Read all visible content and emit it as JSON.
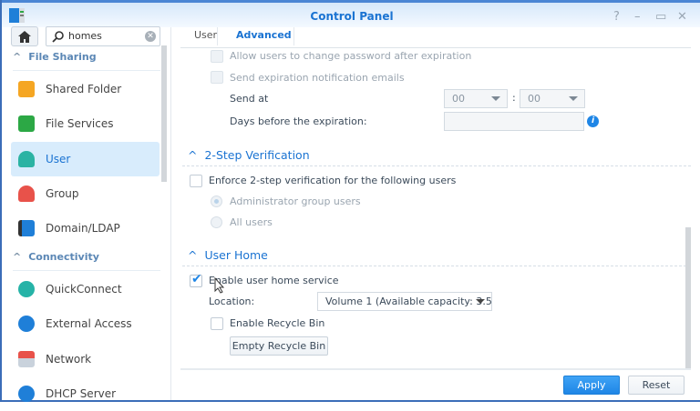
{
  "window": {
    "title": "Control Panel",
    "controls": {
      "help": "?",
      "minimize": "–",
      "maximize": "▭",
      "close": "✕"
    }
  },
  "sidebar": {
    "search": {
      "value": "homes"
    },
    "sections": [
      {
        "label": "File Sharing",
        "items": [
          {
            "label": "Shared Folder",
            "icon": "shared-folder-icon",
            "color": "#f5a623"
          },
          {
            "label": "File Services",
            "icon": "file-services-icon",
            "color": "#2ca845"
          },
          {
            "label": "User",
            "icon": "user-icon",
            "color": "#2bb3a3",
            "selected": true
          },
          {
            "label": "Group",
            "icon": "group-icon",
            "color": "#e8524a"
          },
          {
            "label": "Domain/LDAP",
            "icon": "domain-ldap-icon",
            "color": "#1f7fd8"
          }
        ]
      },
      {
        "label": "Connectivity",
        "items": [
          {
            "label": "QuickConnect",
            "icon": "quickconnect-icon",
            "color": "#26b3a7"
          },
          {
            "label": "External Access",
            "icon": "external-access-icon",
            "color": "#1f7fd8"
          },
          {
            "label": "Network",
            "icon": "network-icon",
            "color": "#e8524a"
          },
          {
            "label": "DHCP Server",
            "icon": "dhcp-server-icon",
            "color": "#1f7fd8"
          }
        ]
      }
    ]
  },
  "tabs": [
    {
      "label": "User"
    },
    {
      "label": "Advanced",
      "active": true
    }
  ],
  "password_expiration": {
    "allow_change": "Allow users to change password after expiration",
    "send_emails": "Send expiration notification emails",
    "send_at_label": "Send at",
    "hour": "00",
    "separator": ":",
    "minute": "00",
    "days_label": "Days before the expiration:",
    "days_value": ""
  },
  "two_step": {
    "title": "2-Step Verification",
    "enforce": "Enforce 2-step verification for the following users",
    "options": [
      "Administrator group users",
      "All users"
    ],
    "selected": 0
  },
  "user_home": {
    "title": "User Home",
    "enable": "Enable user home service",
    "enabled": true,
    "location_label": "Location:",
    "location_value": "Volume 1 (Available capacity:  3.5(",
    "recycle": "Enable Recycle Bin",
    "recycle_enabled": false,
    "empty_btn": "Empty Recycle Bin"
  },
  "footer": {
    "apply": "Apply",
    "reset": "Reset"
  },
  "colors": {
    "accent": "#1a73d2",
    "selected_bg": "#d8ecfc"
  }
}
